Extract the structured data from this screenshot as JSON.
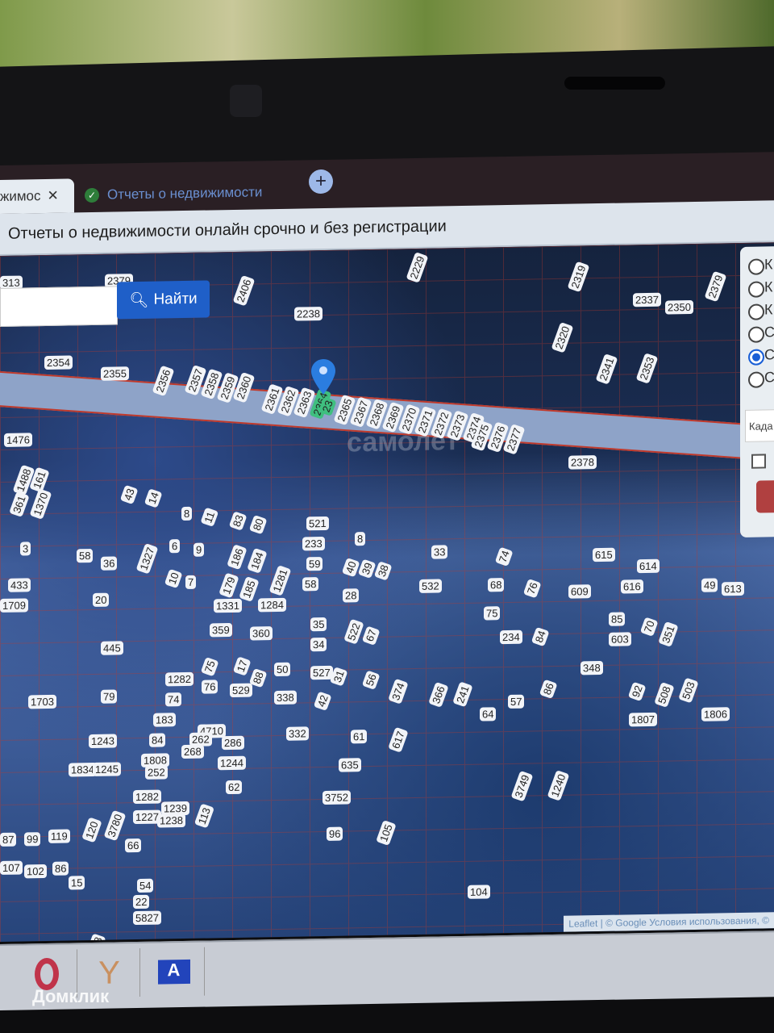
{
  "browser": {
    "active_tab_title": "жимос",
    "other_tab_title": "Отчеты о недвижимости",
    "close_glyph": "✕",
    "new_tab_glyph": "+",
    "page_heading": "Отчеты о недвижимости онлайн срочно и без регистрации"
  },
  "search": {
    "button_label": "Найти",
    "input_value": ""
  },
  "panel": {
    "radio_labels": [
      "К",
      "К",
      "К",
      "С",
      "С",
      "С"
    ],
    "selected_index": 4,
    "field_label": "Када"
  },
  "map": {
    "watermark": "самолет",
    "attribution": "Leaflet | © Google  Условия использования, © ",
    "highlighted_plot": "2364",
    "plots": [
      "313",
      "2379",
      "2406",
      "2238",
      "2229",
      "2319",
      "2337",
      "2350",
      "2379",
      "2320",
      "2341",
      "2353",
      "2354",
      "2355",
      "2356",
      "2357",
      "2358",
      "2359",
      "2360",
      "2361",
      "2362",
      "2363",
      "2364",
      "23",
      "2365",
      "2367",
      "2368",
      "2369",
      "2370",
      "2371",
      "2372",
      "2373",
      "2374",
      "2375",
      "2376",
      "2377",
      "2378",
      "1476",
      "1488",
      "161",
      "361",
      "1370",
      "43",
      "14",
      "8",
      "11",
      "83",
      "80",
      "521",
      "233",
      "8",
      "3",
      "58",
      "36",
      "1327",
      "6",
      "9",
      "186",
      "184",
      "59",
      "40",
      "39",
      "38",
      "33",
      "74",
      "615",
      "614",
      "433",
      "1709",
      "20",
      "10",
      "7",
      "179",
      "185",
      "1281",
      "58",
      "28",
      "532",
      "68",
      "76",
      "609",
      "616",
      "49",
      "613",
      "1331",
      "1284",
      "359",
      "360",
      "35",
      "34",
      "522",
      "67",
      "75",
      "234",
      "84",
      "85",
      "603",
      "70",
      "351",
      "445",
      "1282",
      "75",
      "17",
      "88",
      "50",
      "527",
      "31",
      "56",
      "348",
      "1703",
      "79",
      "74",
      "76",
      "529",
      "338",
      "42",
      "374",
      "366",
      "241",
      "86",
      "57",
      "64",
      "92",
      "508",
      "503",
      "1806",
      "183",
      "4710",
      "262",
      "286",
      "332",
      "61",
      "617",
      "1807",
      "1243",
      "84",
      "268",
      "1244",
      "1808",
      "1834",
      "1245",
      "252",
      "635",
      "62",
      "3752",
      "3749",
      "1240",
      "1282",
      "1239",
      "1227",
      "1238",
      "113",
      "87",
      "99",
      "119",
      "120",
      "3780",
      "66",
      "96",
      "105",
      "107",
      "102",
      "86",
      "15",
      "54",
      "22",
      "5827",
      "104",
      "28"
    ]
  },
  "taskbar": {
    "watermark_text": "Домклик",
    "items": [
      "opera",
      "yandex",
      "app-a"
    ]
  }
}
